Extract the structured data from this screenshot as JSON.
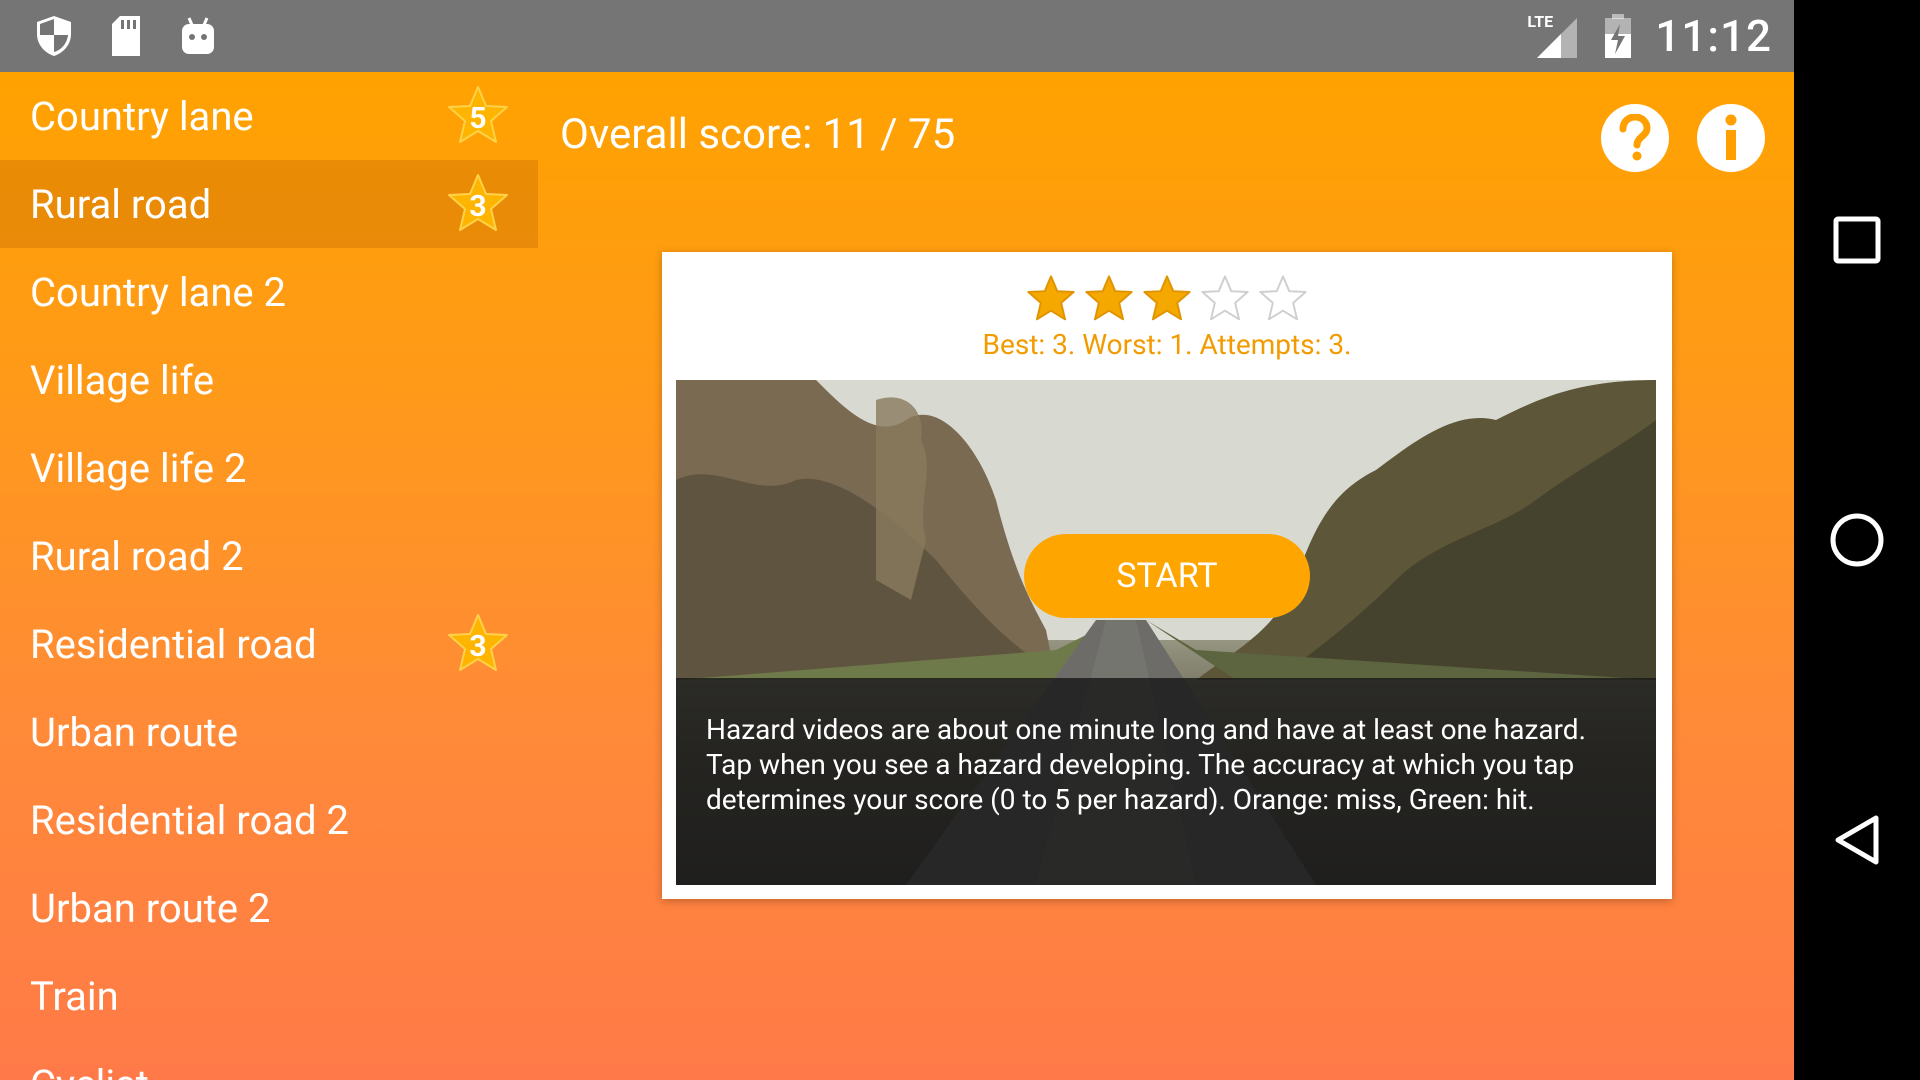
{
  "status_bar": {
    "time": "11:12",
    "left_icons": [
      "shield-icon",
      "sd-card-icon",
      "android-icon"
    ],
    "right_icons": [
      "lte-signal-icon",
      "battery-icon"
    ],
    "lte": "LTE"
  },
  "sidebar": {
    "items": [
      {
        "label": "Country lane",
        "badge": "5",
        "selected": false
      },
      {
        "label": "Rural road",
        "badge": "3",
        "selected": true
      },
      {
        "label": "Country lane 2",
        "badge": "",
        "selected": false
      },
      {
        "label": "Village life",
        "badge": "",
        "selected": false
      },
      {
        "label": "Village life 2",
        "badge": "",
        "selected": false
      },
      {
        "label": "Rural road 2",
        "badge": "",
        "selected": false
      },
      {
        "label": "Residential road",
        "badge": "3",
        "selected": false
      },
      {
        "label": "Urban route",
        "badge": "",
        "selected": false
      },
      {
        "label": "Residential road 2",
        "badge": "",
        "selected": false
      },
      {
        "label": "Urban route 2",
        "badge": "",
        "selected": false
      },
      {
        "label": "Train",
        "badge": "",
        "selected": false
      },
      {
        "label": "Cyclist",
        "badge": "",
        "selected": false
      }
    ]
  },
  "header": {
    "score": "Overall score: 11 / 75",
    "help_icon": "question-icon",
    "info_icon": "info-icon"
  },
  "card": {
    "rating": 3,
    "rating_max": 5,
    "stats": "Best: 3. Worst: 1. Attempts: 3.",
    "start_label": "START",
    "description": "Hazard videos are about one minute long and have at least one hazard. Tap when you see a hazard developing. The accuracy at which you tap determines your score (0 to 5 per hazard). Orange: miss, Green: hit."
  },
  "colors": {
    "accent": "#ffa500",
    "star_filled": "#f5a800",
    "stats_text": "#f29b00",
    "status_bar": "#757575"
  },
  "navigation_bar": {
    "icons": [
      "recents-square-icon",
      "home-circle-icon",
      "back-triangle-icon"
    ]
  }
}
